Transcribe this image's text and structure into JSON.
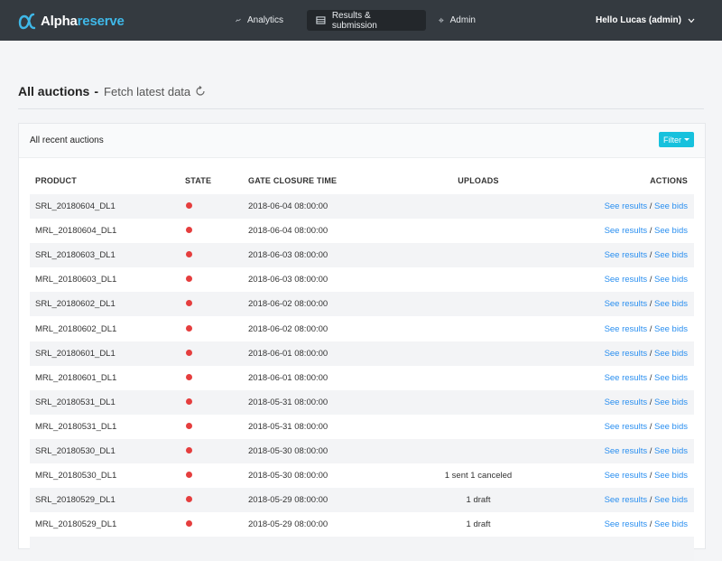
{
  "brand": {
    "part1": "Alpha",
    "part2": "reserve",
    "accent": "#3fb8e8"
  },
  "nav": {
    "items": [
      {
        "label": "Analytics",
        "icon": "line-chart-icon"
      },
      {
        "label": "Results & submission",
        "icon": "table-icon",
        "active": true
      },
      {
        "label": "Admin",
        "icon": "gear-icon"
      }
    ],
    "user": "Hello Lucas (admin)"
  },
  "page": {
    "title": "All auctions",
    "dash": "-",
    "fetch_label": "Fetch latest data"
  },
  "card": {
    "title": "All recent auctions",
    "filter_label": "Filter"
  },
  "table": {
    "columns": [
      "PRODUCT",
      "STATE",
      "GATE CLOSURE TIME",
      "UPLOADS",
      "ACTIONS"
    ],
    "action_results": "See results",
    "action_sep": "/",
    "action_bids": "See bids",
    "state_color": "#e53e3e",
    "rows": [
      {
        "product": "SRL_20180604_DL1",
        "gate": "2018-06-04 08:00:00",
        "uploads": ""
      },
      {
        "product": "MRL_20180604_DL1",
        "gate": "2018-06-04 08:00:00",
        "uploads": ""
      },
      {
        "product": "SRL_20180603_DL1",
        "gate": "2018-06-03 08:00:00",
        "uploads": ""
      },
      {
        "product": "MRL_20180603_DL1",
        "gate": "2018-06-03 08:00:00",
        "uploads": ""
      },
      {
        "product": "SRL_20180602_DL1",
        "gate": "2018-06-02 08:00:00",
        "uploads": ""
      },
      {
        "product": "MRL_20180602_DL1",
        "gate": "2018-06-02 08:00:00",
        "uploads": ""
      },
      {
        "product": "SRL_20180601_DL1",
        "gate": "2018-06-01 08:00:00",
        "uploads": ""
      },
      {
        "product": "MRL_20180601_DL1",
        "gate": "2018-06-01 08:00:00",
        "uploads": ""
      },
      {
        "product": "SRL_20180531_DL1",
        "gate": "2018-05-31 08:00:00",
        "uploads": ""
      },
      {
        "product": "MRL_20180531_DL1",
        "gate": "2018-05-31 08:00:00",
        "uploads": ""
      },
      {
        "product": "SRL_20180530_DL1",
        "gate": "2018-05-30 08:00:00",
        "uploads": ""
      },
      {
        "product": "MRL_20180530_DL1",
        "gate": "2018-05-30 08:00:00",
        "uploads": "1 sent 1 canceled"
      },
      {
        "product": "SRL_20180529_DL1",
        "gate": "2018-05-29 08:00:00",
        "uploads": "1 draft"
      },
      {
        "product": "MRL_20180529_DL1",
        "gate": "2018-05-29 08:00:00",
        "uploads": "1 draft"
      },
      {
        "product": "",
        "gate": "",
        "uploads": ""
      }
    ]
  }
}
